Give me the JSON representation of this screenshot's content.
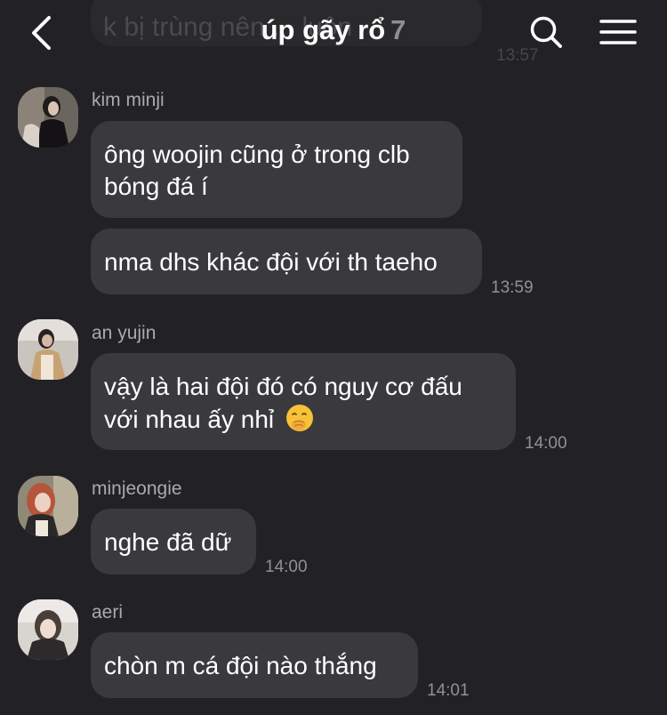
{
  "header": {
    "title": "úp gãy rổ",
    "member_count": "7",
    "back_icon": "chevron-left-icon",
    "search_icon": "search-icon",
    "menu_icon": "hamburger-menu-icon",
    "scrolled_message_text": "k bị trùng nên ... luôn",
    "scrolled_message_time": "13:57"
  },
  "messages": [
    {
      "sender": "kim minji",
      "bubbles": [
        "ông woojin cũng ở trong clb bóng đá í",
        "nma dhs khác đội với th taeho"
      ],
      "time": "13:59"
    },
    {
      "sender": "an yujin",
      "bubbles": [
        "vậy là hai đội đó có nguy cơ đấu với nhau ấy nhỉ"
      ],
      "emoji": "face-with-hand-over-mouth-icon",
      "time": "14:00"
    },
    {
      "sender": "minjeongie",
      "bubbles": [
        "nghe đã dữ"
      ],
      "time": "14:00"
    },
    {
      "sender": "aeri",
      "bubbles": [
        "chòn m cá đội nào thắng"
      ],
      "time": "14:01"
    }
  ],
  "colors": {
    "background": "#222226",
    "bubble": "#3a3a3e",
    "text": "#ffffff",
    "meta_text": "#909095"
  }
}
